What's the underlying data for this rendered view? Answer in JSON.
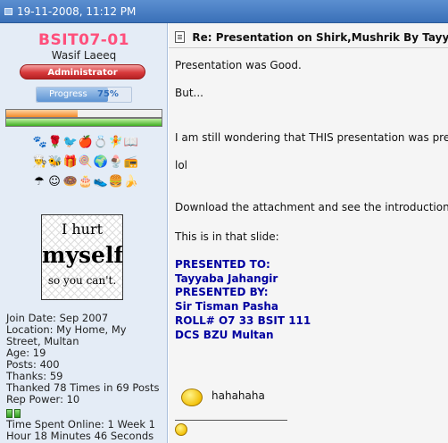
{
  "header": {
    "date": "19-11-2008, 11:12 PM"
  },
  "user": {
    "username": "BSIT07-01",
    "real_name": "Wasif Laeeq",
    "rank": "Administrator",
    "progress_label": "Progress",
    "progress_value": "75%",
    "progress_fraction": 0.75,
    "bar1_fraction": 0.46,
    "bar2_fraction": 1.0,
    "avatar_lines": [
      "I hurt",
      "myself",
      "so you can't."
    ],
    "info": [
      "Join Date: Sep 2007",
      "Location: My Home, My",
      "Street, Multan",
      "Age: 19",
      "Posts: 400",
      "Thanks: 59",
      "Thanked 78 Times in 69 Posts",
      "Rep Power: 10"
    ],
    "online": [
      "Time Spent Online: 1 Week 1",
      "Hour 18 Minutes 46 Seconds"
    ]
  },
  "icons": [
    [
      "paw-icon",
      "flower-icon",
      "bird-icon",
      "apple-icon",
      "ring-icon",
      "fairy-icon",
      "book-icon"
    ],
    [
      "chef-icon",
      "bee-icon",
      "gift-icon",
      "candy-icon",
      "globe-icon",
      "sundae-icon",
      "radio-icon"
    ],
    [
      "umbrella-icon",
      "smiley-icon",
      "donut-icon",
      "cake-icon",
      "shoes-icon",
      "burger-icon",
      "banana-icon"
    ]
  ],
  "icon_glyphs": [
    [
      "🐾",
      "🌹",
      "🐦",
      "🍎",
      "💍",
      "🧚",
      "📖"
    ],
    [
      "👨‍🍳",
      "🐝",
      "🎁",
      "🍭",
      "🌍",
      "🍨",
      "📻"
    ],
    [
      "☂",
      "☺",
      "🍩",
      "🎂",
      "👟",
      "🍔",
      "🍌"
    ]
  ],
  "post": {
    "title": "Re: Presentation on Shirk,Mushrik By Tayyaba",
    "lines": [
      "Presentation was Good.",
      "But...",
      "I am still wondering that THIS presentation was presented b",
      "lol",
      "Download the attachment and see the introduction slide",
      "This is in that slide:"
    ],
    "blue_lines": [
      "PRESENTED TO:",
      "Tayyaba Jahangir",
      "PRESENTED BY:",
      " Sir Tisman Pasha",
      "ROLL# O7 33 BSIT 111",
      "DCS BZU Multan"
    ],
    "laugh_text": "hahahaha"
  }
}
